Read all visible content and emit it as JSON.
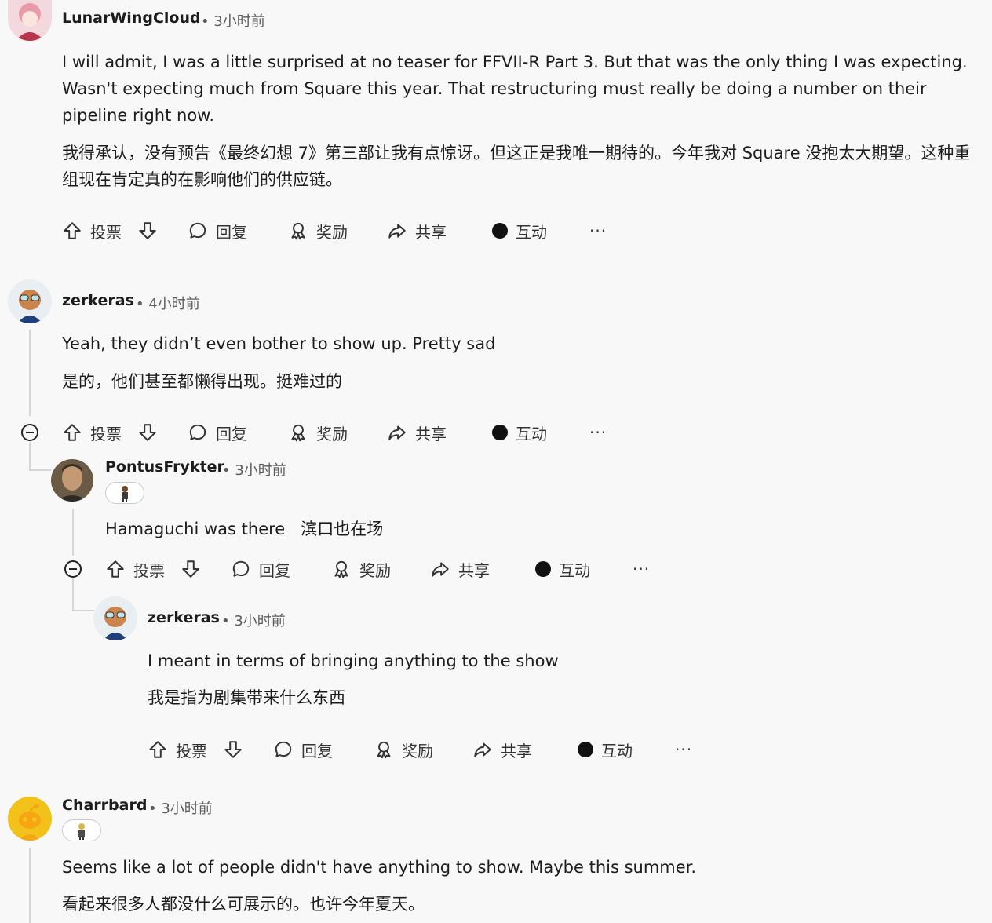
{
  "actions": {
    "vote": "投票",
    "reply": "回复",
    "award": "奖励",
    "share": "共享",
    "interact": "互动",
    "more": "···"
  },
  "comments": [
    {
      "username": "LunarWingCloud",
      "time": "• 3小时前",
      "text_en": "I will admit, I was a little surprised at no teaser for FFVII-R Part 3. But that was the only thing I was expecting. Wasn't expecting much from Square this year. That restructuring must really be doing a number on their pipeline right now.",
      "text_zh": "我得承认，没有预告《最终幻想 7》第三部让我有点惊讶。但这正是我唯一期待的。今年我对 Square 没抱太大期望。这种重组现在肯定真的在影响他们的供应链。"
    },
    {
      "username": "zerkeras",
      "time": "• 4小时前",
      "text_en": "Yeah, they didn’t even bother to show up. Pretty sad",
      "text_zh": "是的，他们甚至都懒得出现。挺难过的"
    },
    {
      "username": "PontusFrykter",
      "time": "• 3小时前",
      "text_en": "Hamaguchi was there",
      "text_zh": "滨口也在场"
    },
    {
      "username": "zerkeras",
      "time": "• 3小时前",
      "text_en": "I meant in terms of bringing anything to the show",
      "text_zh": "我是指为剧集带来什么东西"
    },
    {
      "username": "Charrbard",
      "time": "• 3小时前",
      "text_en": "Seems like a lot of people didn't have anything to show. Maybe this summer.",
      "text_zh": "看起来很多人都没什么可展示的。也许今年夏天。"
    }
  ]
}
